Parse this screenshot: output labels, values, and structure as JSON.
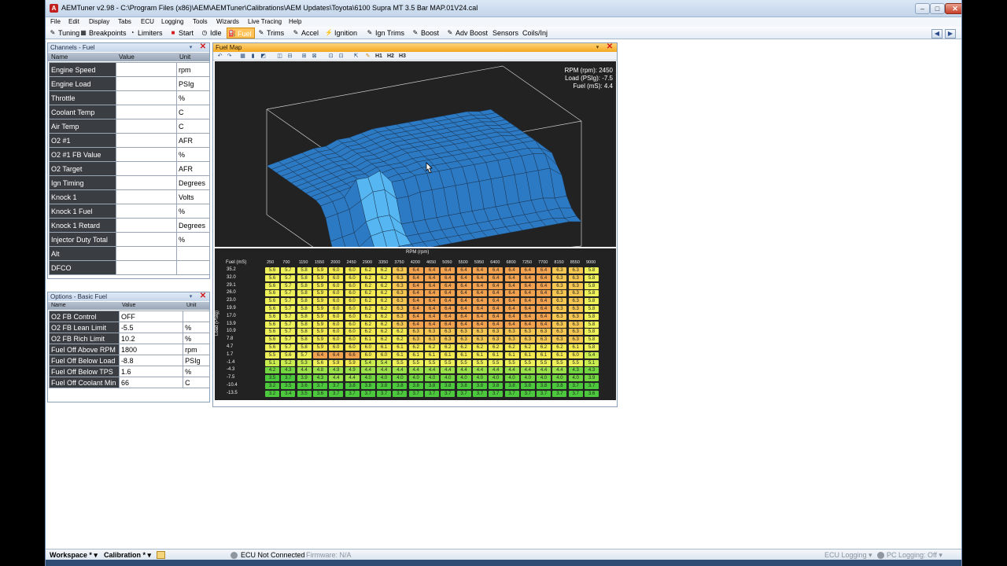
{
  "window": {
    "title": "AEMTuner v2.98 - C:\\Program Files (x86)\\AEM\\AEMTuner\\Calibrations\\AEM Updates\\Toyota\\6100 Supra MT 3.5 Bar MAP.01V24.cal",
    "minimize": "–",
    "maximize": "□",
    "close": "✕"
  },
  "menu": [
    "File",
    "Edit",
    "Display",
    "Tabs",
    "ECU",
    "Logging",
    "Tools",
    "Wizards",
    "Live Tracing",
    "Help"
  ],
  "tabs": [
    {
      "label": "Tuning",
      "icon": "✎"
    },
    {
      "label": "Breakpoints",
      "icon": "▦"
    },
    {
      "label": "Limiters",
      "icon": "◔"
    },
    {
      "label": "Start",
      "icon": "■"
    },
    {
      "label": "Idle",
      "icon": "◷"
    },
    {
      "label": "Fuel",
      "icon": "⛽"
    },
    {
      "label": "Trims",
      "icon": "✎"
    },
    {
      "label": "Accel",
      "icon": "✎"
    },
    {
      "label": "Ignition",
      "icon": "⚡"
    },
    {
      "label": "Ign Trims",
      "icon": "✎"
    },
    {
      "label": "Boost",
      "icon": "✎"
    },
    {
      "label": "Adv Boost",
      "icon": "✎"
    },
    {
      "label": "Sensors",
      "icon": ""
    },
    {
      "label": "Coils/Inj",
      "icon": ""
    }
  ],
  "nav": {
    "back": "◀",
    "forward": "▶"
  },
  "channels_panel": {
    "title": "Channels - Fuel",
    "headers": [
      "Name",
      "Value",
      "Unit"
    ],
    "rows": [
      {
        "name": "Engine Speed",
        "value": "",
        "unit": "rpm"
      },
      {
        "name": "Engine Load",
        "value": "",
        "unit": "PSIg"
      },
      {
        "name": "Throttle",
        "value": "",
        "unit": "%"
      },
      {
        "name": "Coolant Temp",
        "value": "",
        "unit": "C"
      },
      {
        "name": "Air Temp",
        "value": "",
        "unit": "C"
      },
      {
        "name": "O2 #1",
        "value": "",
        "unit": "AFR"
      },
      {
        "name": "O2 #1 FB Value",
        "value": "",
        "unit": "%"
      },
      {
        "name": "O2 Target",
        "value": "",
        "unit": "AFR"
      },
      {
        "name": "Ign Timing",
        "value": "",
        "unit": "Degrees"
      },
      {
        "name": "Knock 1",
        "value": "",
        "unit": "Volts"
      },
      {
        "name": "Knock 1 Fuel",
        "value": "",
        "unit": "%"
      },
      {
        "name": "Knock 1 Retard",
        "value": "",
        "unit": "Degrees"
      },
      {
        "name": "Injector Duty Total",
        "value": "",
        "unit": "%"
      },
      {
        "name": "Alt",
        "value": "",
        "unit": ""
      },
      {
        "name": "DFCO",
        "value": "",
        "unit": ""
      }
    ]
  },
  "options_panel": {
    "title": "Options - Basic Fuel",
    "headers": [
      "Name",
      "Value",
      "Unit"
    ],
    "rows": [
      {
        "name": "O2 FB Control",
        "value": "OFF",
        "unit": ""
      },
      {
        "name": "O2 FB Lean Limit",
        "value": "-5.5",
        "unit": "%"
      },
      {
        "name": "O2 FB Rich Limit",
        "value": "10.2",
        "unit": "%"
      },
      {
        "name": "Fuel Off Above RPM",
        "value": "1800",
        "unit": "rpm"
      },
      {
        "name": "Fuel Off Below Load",
        "value": "-8.8",
        "unit": "PSIg"
      },
      {
        "name": "Fuel Off Below TPS",
        "value": "1.6",
        "unit": "%"
      },
      {
        "name": "Fuel Off Coolant Min",
        "value": "66",
        "unit": "C"
      }
    ]
  },
  "fuel_map": {
    "title": "Fuel Map",
    "toolbar_labels": [
      "H1",
      "H2",
      "H3"
    ],
    "readout": {
      "rpm": "RPM (rpm): 2450",
      "load": "Load (PSIg): -7.5",
      "fuel": "Fuel (mS): 4.4"
    },
    "grid_title": "Fuel (mS)",
    "x_axis_label": "RPM (rpm)",
    "y_axis_label": "Load (PSIg)",
    "rpm_breakpoints": [
      "250",
      "700",
      "1150",
      "1550",
      "2000",
      "2450",
      "2900",
      "3350",
      "3750",
      "4200",
      "4650",
      "5050",
      "5500",
      "5950",
      "6400",
      "6800",
      "7250",
      "7700",
      "8150",
      "8550",
      "9000"
    ],
    "load_breakpoints": [
      "35.2",
      "32.0",
      "29.1",
      "26.0",
      "23.0",
      "19.9",
      "17.0",
      "13.9",
      "10.9",
      "7.8",
      "4.7",
      "1.7",
      "-1.4",
      "-4.3",
      "-7.5",
      "-10.4",
      "-13.5"
    ],
    "values": [
      [
        "5.6",
        "5.7",
        "5.8",
        "5.9",
        "6.0",
        "6.0",
        "6.2",
        "6.2",
        "6.3",
        "6.4",
        "6.4",
        "6.4",
        "6.4",
        "6.4",
        "6.4",
        "6.4",
        "6.4",
        "6.4",
        "6.3",
        "6.3",
        "5.8"
      ],
      [
        "5.6",
        "5.7",
        "5.8",
        "5.9",
        "6.0",
        "6.0",
        "6.2",
        "6.2",
        "6.3",
        "6.4",
        "6.4",
        "6.4",
        "6.4",
        "6.4",
        "6.4",
        "6.4",
        "6.4",
        "6.4",
        "6.3",
        "6.3",
        "5.8"
      ],
      [
        "5.6",
        "5.7",
        "5.8",
        "5.9",
        "6.0",
        "6.0",
        "6.2",
        "6.2",
        "6.3",
        "6.4",
        "6.4",
        "6.4",
        "6.4",
        "6.4",
        "6.4",
        "6.4",
        "6.4",
        "6.4",
        "6.3",
        "6.3",
        "5.8"
      ],
      [
        "5.6",
        "5.7",
        "5.8",
        "5.9",
        "6.0",
        "6.0",
        "6.2",
        "6.2",
        "6.3",
        "6.4",
        "6.4",
        "6.4",
        "6.4",
        "6.4",
        "6.4",
        "6.4",
        "6.4",
        "6.4",
        "6.3",
        "6.3",
        "5.8"
      ],
      [
        "5.6",
        "5.7",
        "5.8",
        "5.9",
        "6.0",
        "6.0",
        "6.2",
        "6.2",
        "6.3",
        "6.4",
        "6.4",
        "6.4",
        "6.4",
        "6.4",
        "6.4",
        "6.4",
        "6.4",
        "6.4",
        "6.3",
        "6.3",
        "5.8"
      ],
      [
        "5.6",
        "5.7",
        "5.8",
        "5.9",
        "6.0",
        "6.0",
        "6.2",
        "6.2",
        "6.3",
        "6.4",
        "6.4",
        "6.4",
        "6.4",
        "6.4",
        "6.4",
        "6.4",
        "6.4",
        "6.4",
        "6.3",
        "6.3",
        "5.8"
      ],
      [
        "5.6",
        "5.7",
        "5.8",
        "5.9",
        "6.0",
        "6.0",
        "6.2",
        "6.2",
        "6.3",
        "6.4",
        "6.4",
        "6.4",
        "6.4",
        "6.4",
        "6.4",
        "6.4",
        "6.4",
        "6.4",
        "6.3",
        "6.3",
        "5.8"
      ],
      [
        "5.6",
        "5.7",
        "5.8",
        "5.9",
        "6.0",
        "6.0",
        "6.2",
        "6.2",
        "6.3",
        "6.4",
        "6.4",
        "6.4",
        "6.4",
        "6.4",
        "6.4",
        "6.4",
        "6.4",
        "6.4",
        "6.3",
        "6.3",
        "5.8"
      ],
      [
        "5.6",
        "5.7",
        "5.8",
        "5.9",
        "6.0",
        "6.0",
        "6.2",
        "6.2",
        "6.2",
        "6.3",
        "6.3",
        "6.3",
        "6.3",
        "6.3",
        "6.3",
        "6.3",
        "6.3",
        "6.3",
        "6.3",
        "6.3",
        "5.8"
      ],
      [
        "5.6",
        "5.7",
        "5.8",
        "5.9",
        "6.0",
        "6.0",
        "6.1",
        "6.2",
        "6.2",
        "6.3",
        "6.3",
        "6.3",
        "6.3",
        "6.3",
        "6.3",
        "6.3",
        "6.3",
        "6.3",
        "6.3",
        "6.3",
        "5.8"
      ],
      [
        "5.6",
        "5.7",
        "5.8",
        "5.9",
        "6.0",
        "6.0",
        "6.0",
        "6.1",
        "6.1",
        "6.2",
        "6.2",
        "6.2",
        "6.2",
        "6.2",
        "6.2",
        "6.2",
        "6.2",
        "6.2",
        "6.2",
        "6.1",
        "5.8"
      ],
      [
        "5.5",
        "5.6",
        "5.7",
        "6.4",
        "6.4",
        "6.6",
        "6.0",
        "6.0",
        "6.1",
        "6.1",
        "6.1",
        "6.1",
        "6.1",
        "6.1",
        "6.1",
        "6.1",
        "6.1",
        "6.1",
        "6.1",
        "6.0",
        "5.4"
      ],
      [
        "5.1",
        "5.2",
        "5.3",
        "5.6",
        "5.9",
        "5.9",
        "5.4",
        "5.4",
        "5.5",
        "5.5",
        "5.5",
        "5.5",
        "5.5",
        "5.5",
        "5.5",
        "5.5",
        "5.5",
        "5.5",
        "5.5",
        "5.5",
        "5.1"
      ],
      [
        "4.2",
        "4.3",
        "4.4",
        "4.8",
        "4.9",
        "4.9",
        "4.4",
        "4.4",
        "4.4",
        "4.4",
        "4.4",
        "4.4",
        "4.4",
        "4.4",
        "4.4",
        "4.4",
        "4.4",
        "4.4",
        "4.4",
        "4.3",
        "4.3"
      ],
      [
        "3.5",
        "3.7",
        "3.9",
        "4.3",
        "4.4",
        "4.4",
        "4.0",
        "4.0",
        "4.0",
        "4.0",
        "4.0",
        "4.0",
        "4.0",
        "4.0",
        "4.0",
        "4.0",
        "4.0",
        "4.0",
        "4.0",
        "4.0",
        "3.9"
      ],
      [
        "3.2",
        "3.5",
        "3.6",
        "3.7",
        "3.7",
        "3.8",
        "3.8",
        "3.8",
        "3.8",
        "3.8",
        "3.8",
        "3.8",
        "3.8",
        "3.8",
        "3.8",
        "3.8",
        "3.8",
        "3.8",
        "3.8",
        "3.7",
        "3.7"
      ],
      [
        "3.2",
        "3.4",
        "3.5",
        "3.6",
        "3.7",
        "3.7",
        "3.7",
        "3.7",
        "3.7",
        "3.7",
        "3.7",
        "3.7",
        "3.7",
        "3.7",
        "3.7",
        "3.7",
        "3.7",
        "3.7",
        "3.7",
        "3.7",
        "3.6"
      ]
    ]
  },
  "status": {
    "workspace": "Workspace *",
    "calibration": "Calibration *",
    "ecu": "ECU Not Connected",
    "firmware": "Firmware: N/A",
    "ecu_logging": "ECU Logging",
    "pc_logging": "PC Logging: Off"
  },
  "colors": {
    "active_tab": "#ffc35a",
    "surface": "#2d7ac4",
    "cell_low": "#3cc83c",
    "cell_mid": "#f0ee50",
    "cell_high": "#f0a050"
  }
}
